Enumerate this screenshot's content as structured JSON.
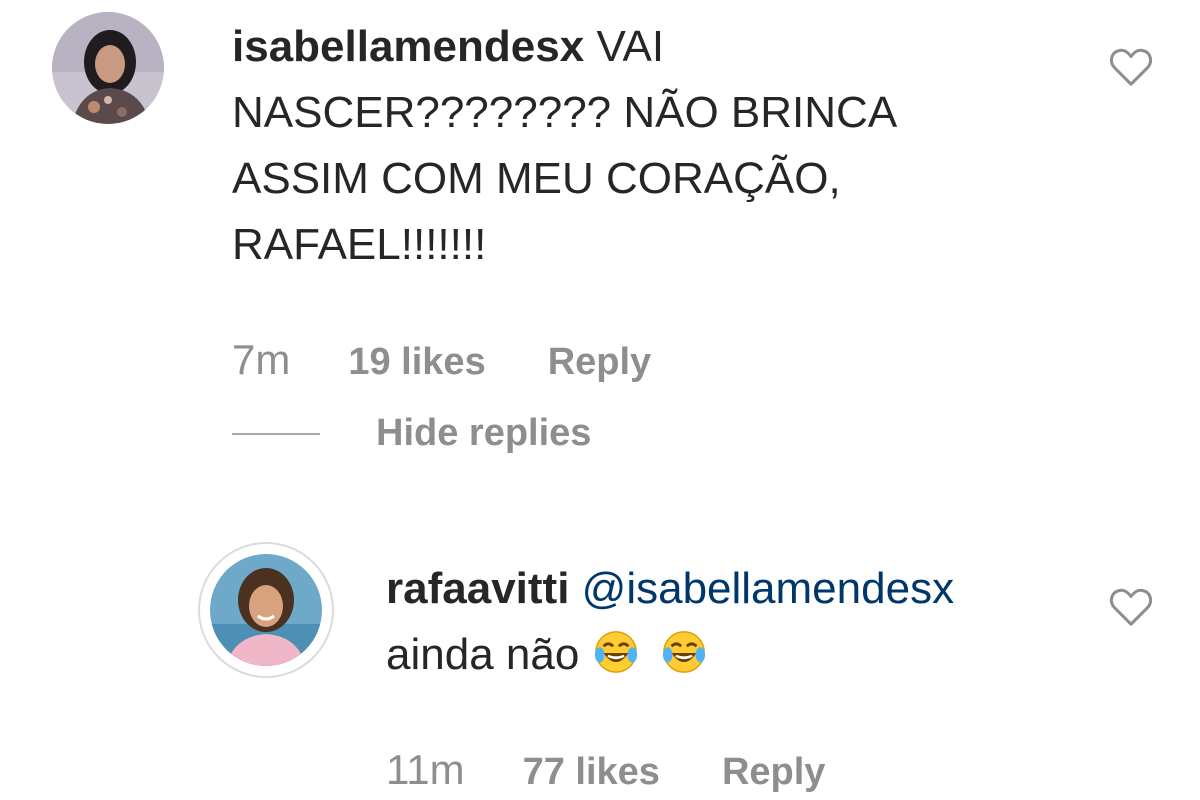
{
  "comments": [
    {
      "username": "isabellamendesx",
      "text_lines": [
        "VAI",
        "NASCER???????? NÃO BRINCA",
        "ASSIM COM MEU CORAÇÃO,",
        "RAFAEL!!!!!!!"
      ],
      "time": "7m",
      "likes": "19 likes",
      "reply_label": "Reply",
      "like_icon": "heart-outline-icon"
    }
  ],
  "replies_toggle": {
    "label": "Hide replies"
  },
  "replies": [
    {
      "username": "rafaavitti",
      "mention": "@isabellamendesx",
      "text": "ainda não",
      "emojis": [
        "face-with-tears-of-joy",
        "face-with-tears-of-joy"
      ],
      "time": "11m",
      "likes": "77 likes",
      "reply_label": "Reply",
      "like_icon": "heart-outline-icon"
    }
  ],
  "colors": {
    "text": "#262626",
    "muted": "#8e8e8e",
    "mention": "#00376b",
    "story_ring": "#dbdbdb"
  }
}
